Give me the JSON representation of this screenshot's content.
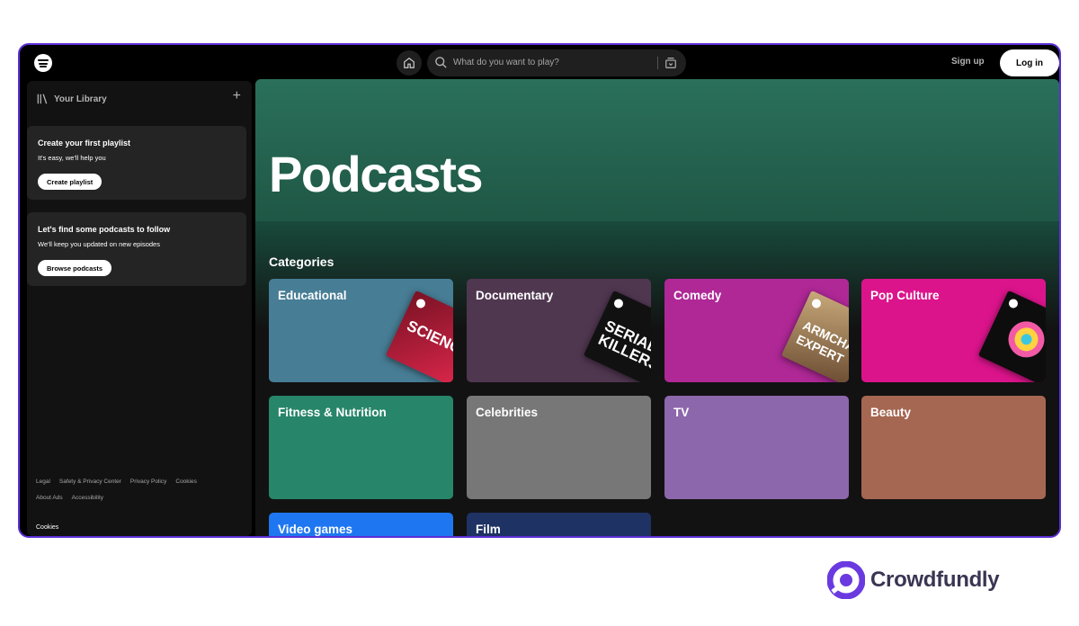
{
  "header": {
    "search_placeholder": "What do you want to play?",
    "signup_label": "Sign up",
    "login_label": "Log in"
  },
  "sidebar": {
    "library_title": "Your Library",
    "playlist_card": {
      "title": "Create your first playlist",
      "subtitle": "It's easy, we'll help you",
      "button": "Create playlist"
    },
    "podcast_card": {
      "title": "Let's find some podcasts to follow",
      "subtitle": "We'll keep you updated on new episodes",
      "button": "Browse podcasts"
    },
    "footer_links_row1": [
      "Legal",
      "Safety & Privacy Center",
      "Privacy Policy",
      "Cookies"
    ],
    "footer_links_row2": [
      "About Ads",
      "Accessibility"
    ],
    "cookies_label": "Cookies"
  },
  "main": {
    "page_title": "Podcasts",
    "categories_title": "Categories",
    "categories": [
      {
        "label": "Educational",
        "color": "#477d95",
        "cover_text": "SCIENCE VS"
      },
      {
        "label": "Documentary",
        "color": "#503750",
        "cover_text": "SERIAL KILLERS"
      },
      {
        "label": "Comedy",
        "color": "#af2896",
        "cover_text": "ARMCHAIR EXPERT"
      },
      {
        "label": "Pop Culture",
        "color": "#dc148c",
        "cover_text": ""
      },
      {
        "label": "Fitness & Nutrition",
        "color": "#27856a",
        "cover_text": ""
      },
      {
        "label": "Celebrities",
        "color": "#777777",
        "cover_text": ""
      },
      {
        "label": "TV",
        "color": "#8d67ab",
        "cover_text": ""
      },
      {
        "label": "Beauty",
        "color": "#a56752",
        "cover_text": ""
      },
      {
        "label": "Video games",
        "color": "#1e77f0",
        "cover_text": ""
      },
      {
        "label": "Film",
        "color": "#1e3264",
        "cover_text": ""
      }
    ]
  },
  "brand": {
    "name": "Crowdfundly",
    "color": "#6a3ae0"
  }
}
